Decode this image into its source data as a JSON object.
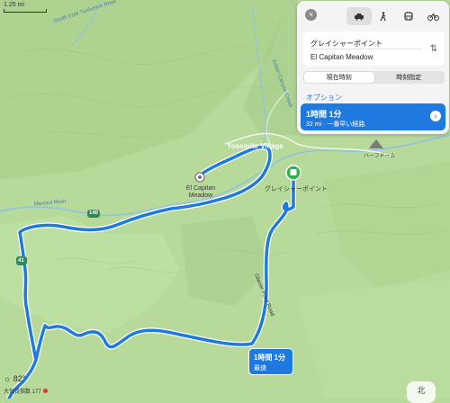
{
  "map": {
    "scale": "1.25 mi",
    "labels": {
      "river_north": "South Fork Tuolumne River",
      "creek": "Indian Canyon Creek",
      "village": "Yosemite Village",
      "el_capitan": "El Capitan Meadow",
      "glacier_point": "グレイシャーポイント",
      "half_dome": "ハーフドーム",
      "merced_river": "Merced River",
      "road_140": "140",
      "road_41": "41",
      "glacier_road": "Glacier Point Road"
    },
    "weather": "☼ 82°",
    "aqi": "大気質指数 177",
    "compass": "北"
  },
  "directions": {
    "close_icon": "×",
    "modes": [
      "car-icon",
      "walk-icon",
      "transit-icon",
      "bike-icon"
    ],
    "from": "グレイシャーポイント",
    "to": "El Capitan Meadow",
    "time_tabs": [
      "現在時刻",
      "時刻指定"
    ],
    "options_label": "オプション",
    "route": {
      "time": "1時間 1分",
      "detail": "32 mi · 一番早い経路"
    }
  },
  "callout": {
    "time": "1時間 1分",
    "label": "最速"
  },
  "colors": {
    "route": "#1f7ae0",
    "terrain": "#b7d99a",
    "valley": "#a9cf8b"
  }
}
